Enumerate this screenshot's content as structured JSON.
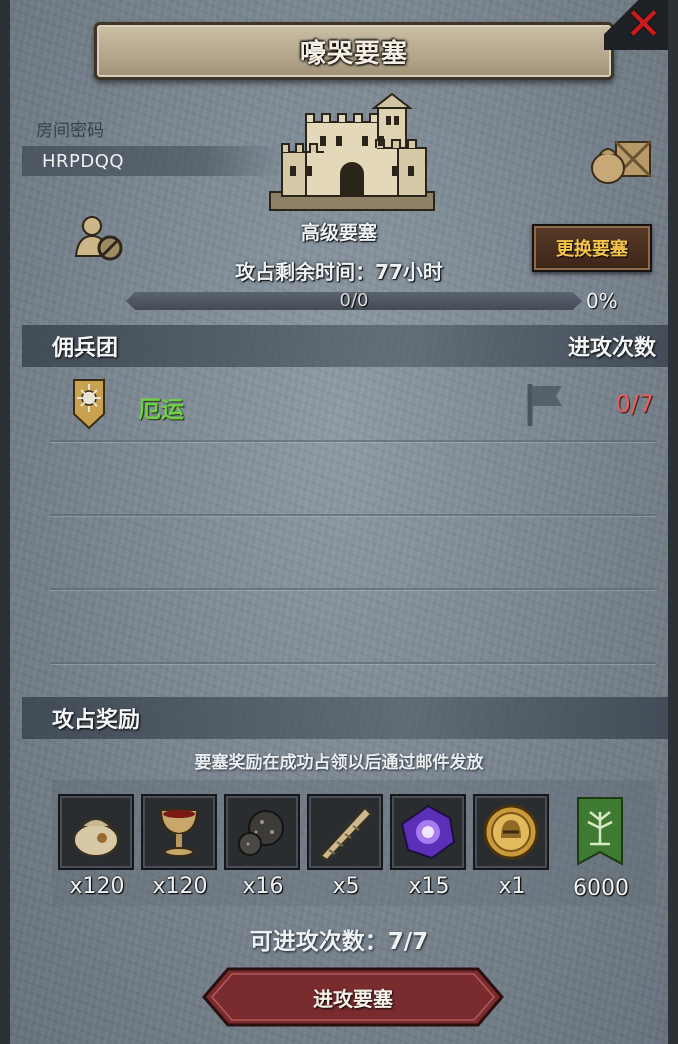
{
  "title": "嚎哭要塞",
  "room": {
    "label": "房间密码",
    "code": "HRPDQQ"
  },
  "fortress": {
    "level": "高级要塞",
    "remaining_time": "攻占剩余时间：77小时",
    "progress_text": "0/0",
    "progress_percent": "0%",
    "progress_fraction": 0,
    "change_button": "更换要塞"
  },
  "mercenary_section": {
    "left_header": "佣兵团",
    "right_header": "进攻次数",
    "rows": [
      {
        "name": "厄运",
        "attacks": "0/7"
      }
    ]
  },
  "rewards_section": {
    "header": "攻占奖励",
    "note": "要塞奖励在成功占领以后通过邮件发放",
    "items": [
      {
        "icon": "pouch-icon",
        "qty": "x120"
      },
      {
        "icon": "goblet-icon",
        "qty": "x120"
      },
      {
        "icon": "ore-icon",
        "qty": "x16"
      },
      {
        "icon": "horn-icon",
        "qty": "x5"
      },
      {
        "icon": "purple-gem-icon",
        "qty": "x15"
      },
      {
        "icon": "helmet-coin-icon",
        "qty": "x1"
      },
      {
        "icon": "green-banner-icon",
        "qty": "6000"
      }
    ]
  },
  "attacks_available": "可进攻次数：7/7",
  "attack_button": "进攻要塞",
  "colors": {
    "merc_name": "#6fcf45",
    "merc_attacks": "#e86060",
    "change_button_text": "#f6c64a",
    "attack_button": "#7a2b2e",
    "close": "#c91b1b"
  }
}
